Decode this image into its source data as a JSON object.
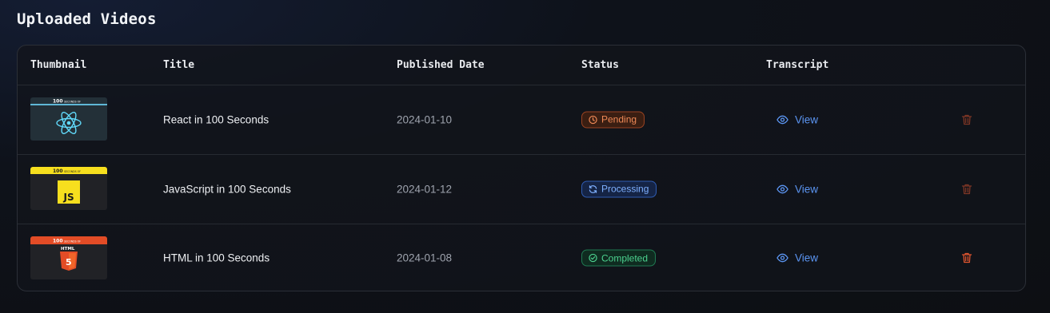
{
  "page": {
    "title": "Uploaded Videos"
  },
  "table": {
    "headers": {
      "thumbnail": "Thumbnail",
      "title": "Title",
      "published": "Published Date",
      "status": "Status",
      "transcript": "Transcript"
    },
    "rows": [
      {
        "title": "React in 100 Seconds",
        "date": "2024-01-10",
        "status": "Pending",
        "transcript_label": "View",
        "thumb": {
          "banner": "100",
          "sub": "SECONDS OF"
        }
      },
      {
        "title": "JavaScript in 100 Seconds",
        "date": "2024-01-12",
        "status": "Processing",
        "transcript_label": "View",
        "thumb": {
          "banner": "100",
          "sub": "SECONDS OF",
          "logo": "JS"
        }
      },
      {
        "title": "HTML in 100 Seconds",
        "date": "2024-01-08",
        "status": "Completed",
        "transcript_label": "View",
        "thumb": {
          "banner": "100",
          "sub": "SECONDS OF",
          "word": "HTML",
          "logo": "5"
        }
      }
    ]
  },
  "colors": {
    "pending": "#f08a57",
    "processing": "#7fb0ff",
    "completed": "#4cd18f",
    "link": "#5b95f2",
    "delete": "#d9532f"
  },
  "icons": {
    "pending": "clock-icon",
    "processing": "refresh-icon",
    "completed": "check-circle-icon",
    "view": "eye-icon",
    "delete": "trash-icon"
  }
}
